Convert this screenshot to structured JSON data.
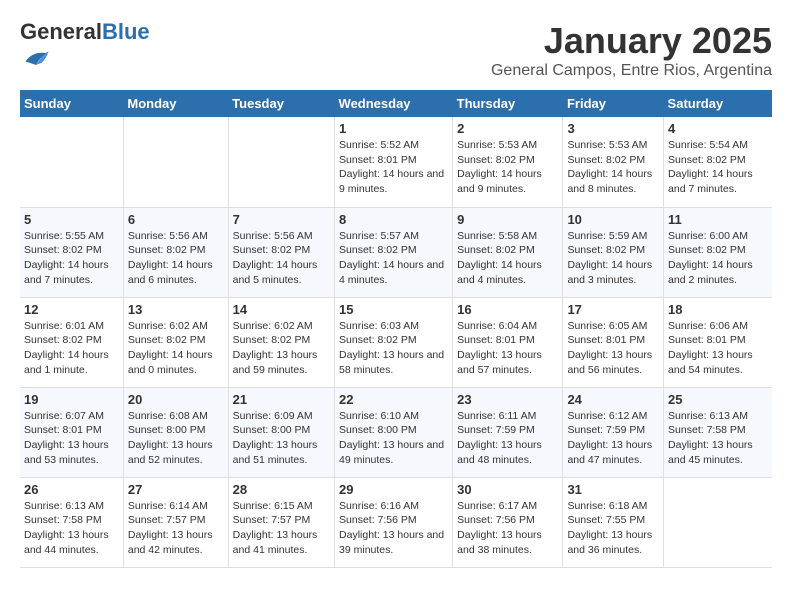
{
  "header": {
    "logo_general": "General",
    "logo_blue": "Blue",
    "main_title": "January 2025",
    "sub_title": "General Campos, Entre Rios, Argentina"
  },
  "days_of_week": [
    "Sunday",
    "Monday",
    "Tuesday",
    "Wednesday",
    "Thursday",
    "Friday",
    "Saturday"
  ],
  "weeks": [
    [
      {
        "day": "",
        "sunrise": "",
        "sunset": "",
        "daylight": ""
      },
      {
        "day": "",
        "sunrise": "",
        "sunset": "",
        "daylight": ""
      },
      {
        "day": "",
        "sunrise": "",
        "sunset": "",
        "daylight": ""
      },
      {
        "day": "1",
        "sunrise": "Sunrise: 5:52 AM",
        "sunset": "Sunset: 8:01 PM",
        "daylight": "Daylight: 14 hours and 9 minutes."
      },
      {
        "day": "2",
        "sunrise": "Sunrise: 5:53 AM",
        "sunset": "Sunset: 8:02 PM",
        "daylight": "Daylight: 14 hours and 9 minutes."
      },
      {
        "day": "3",
        "sunrise": "Sunrise: 5:53 AM",
        "sunset": "Sunset: 8:02 PM",
        "daylight": "Daylight: 14 hours and 8 minutes."
      },
      {
        "day": "4",
        "sunrise": "Sunrise: 5:54 AM",
        "sunset": "Sunset: 8:02 PM",
        "daylight": "Daylight: 14 hours and 7 minutes."
      }
    ],
    [
      {
        "day": "5",
        "sunrise": "Sunrise: 5:55 AM",
        "sunset": "Sunset: 8:02 PM",
        "daylight": "Daylight: 14 hours and 7 minutes."
      },
      {
        "day": "6",
        "sunrise": "Sunrise: 5:56 AM",
        "sunset": "Sunset: 8:02 PM",
        "daylight": "Daylight: 14 hours and 6 minutes."
      },
      {
        "day": "7",
        "sunrise": "Sunrise: 5:56 AM",
        "sunset": "Sunset: 8:02 PM",
        "daylight": "Daylight: 14 hours and 5 minutes."
      },
      {
        "day": "8",
        "sunrise": "Sunrise: 5:57 AM",
        "sunset": "Sunset: 8:02 PM",
        "daylight": "Daylight: 14 hours and 4 minutes."
      },
      {
        "day": "9",
        "sunrise": "Sunrise: 5:58 AM",
        "sunset": "Sunset: 8:02 PM",
        "daylight": "Daylight: 14 hours and 4 minutes."
      },
      {
        "day": "10",
        "sunrise": "Sunrise: 5:59 AM",
        "sunset": "Sunset: 8:02 PM",
        "daylight": "Daylight: 14 hours and 3 minutes."
      },
      {
        "day": "11",
        "sunrise": "Sunrise: 6:00 AM",
        "sunset": "Sunset: 8:02 PM",
        "daylight": "Daylight: 14 hours and 2 minutes."
      }
    ],
    [
      {
        "day": "12",
        "sunrise": "Sunrise: 6:01 AM",
        "sunset": "Sunset: 8:02 PM",
        "daylight": "Daylight: 14 hours and 1 minute."
      },
      {
        "day": "13",
        "sunrise": "Sunrise: 6:02 AM",
        "sunset": "Sunset: 8:02 PM",
        "daylight": "Daylight: 14 hours and 0 minutes."
      },
      {
        "day": "14",
        "sunrise": "Sunrise: 6:02 AM",
        "sunset": "Sunset: 8:02 PM",
        "daylight": "Daylight: 13 hours and 59 minutes."
      },
      {
        "day": "15",
        "sunrise": "Sunrise: 6:03 AM",
        "sunset": "Sunset: 8:02 PM",
        "daylight": "Daylight: 13 hours and 58 minutes."
      },
      {
        "day": "16",
        "sunrise": "Sunrise: 6:04 AM",
        "sunset": "Sunset: 8:01 PM",
        "daylight": "Daylight: 13 hours and 57 minutes."
      },
      {
        "day": "17",
        "sunrise": "Sunrise: 6:05 AM",
        "sunset": "Sunset: 8:01 PM",
        "daylight": "Daylight: 13 hours and 56 minutes."
      },
      {
        "day": "18",
        "sunrise": "Sunrise: 6:06 AM",
        "sunset": "Sunset: 8:01 PM",
        "daylight": "Daylight: 13 hours and 54 minutes."
      }
    ],
    [
      {
        "day": "19",
        "sunrise": "Sunrise: 6:07 AM",
        "sunset": "Sunset: 8:01 PM",
        "daylight": "Daylight: 13 hours and 53 minutes."
      },
      {
        "day": "20",
        "sunrise": "Sunrise: 6:08 AM",
        "sunset": "Sunset: 8:00 PM",
        "daylight": "Daylight: 13 hours and 52 minutes."
      },
      {
        "day": "21",
        "sunrise": "Sunrise: 6:09 AM",
        "sunset": "Sunset: 8:00 PM",
        "daylight": "Daylight: 13 hours and 51 minutes."
      },
      {
        "day": "22",
        "sunrise": "Sunrise: 6:10 AM",
        "sunset": "Sunset: 8:00 PM",
        "daylight": "Daylight: 13 hours and 49 minutes."
      },
      {
        "day": "23",
        "sunrise": "Sunrise: 6:11 AM",
        "sunset": "Sunset: 7:59 PM",
        "daylight": "Daylight: 13 hours and 48 minutes."
      },
      {
        "day": "24",
        "sunrise": "Sunrise: 6:12 AM",
        "sunset": "Sunset: 7:59 PM",
        "daylight": "Daylight: 13 hours and 47 minutes."
      },
      {
        "day": "25",
        "sunrise": "Sunrise: 6:13 AM",
        "sunset": "Sunset: 7:58 PM",
        "daylight": "Daylight: 13 hours and 45 minutes."
      }
    ],
    [
      {
        "day": "26",
        "sunrise": "Sunrise: 6:13 AM",
        "sunset": "Sunset: 7:58 PM",
        "daylight": "Daylight: 13 hours and 44 minutes."
      },
      {
        "day": "27",
        "sunrise": "Sunrise: 6:14 AM",
        "sunset": "Sunset: 7:57 PM",
        "daylight": "Daylight: 13 hours and 42 minutes."
      },
      {
        "day": "28",
        "sunrise": "Sunrise: 6:15 AM",
        "sunset": "Sunset: 7:57 PM",
        "daylight": "Daylight: 13 hours and 41 minutes."
      },
      {
        "day": "29",
        "sunrise": "Sunrise: 6:16 AM",
        "sunset": "Sunset: 7:56 PM",
        "daylight": "Daylight: 13 hours and 39 minutes."
      },
      {
        "day": "30",
        "sunrise": "Sunrise: 6:17 AM",
        "sunset": "Sunset: 7:56 PM",
        "daylight": "Daylight: 13 hours and 38 minutes."
      },
      {
        "day": "31",
        "sunrise": "Sunrise: 6:18 AM",
        "sunset": "Sunset: 7:55 PM",
        "daylight": "Daylight: 13 hours and 36 minutes."
      },
      {
        "day": "",
        "sunrise": "",
        "sunset": "",
        "daylight": ""
      }
    ]
  ]
}
